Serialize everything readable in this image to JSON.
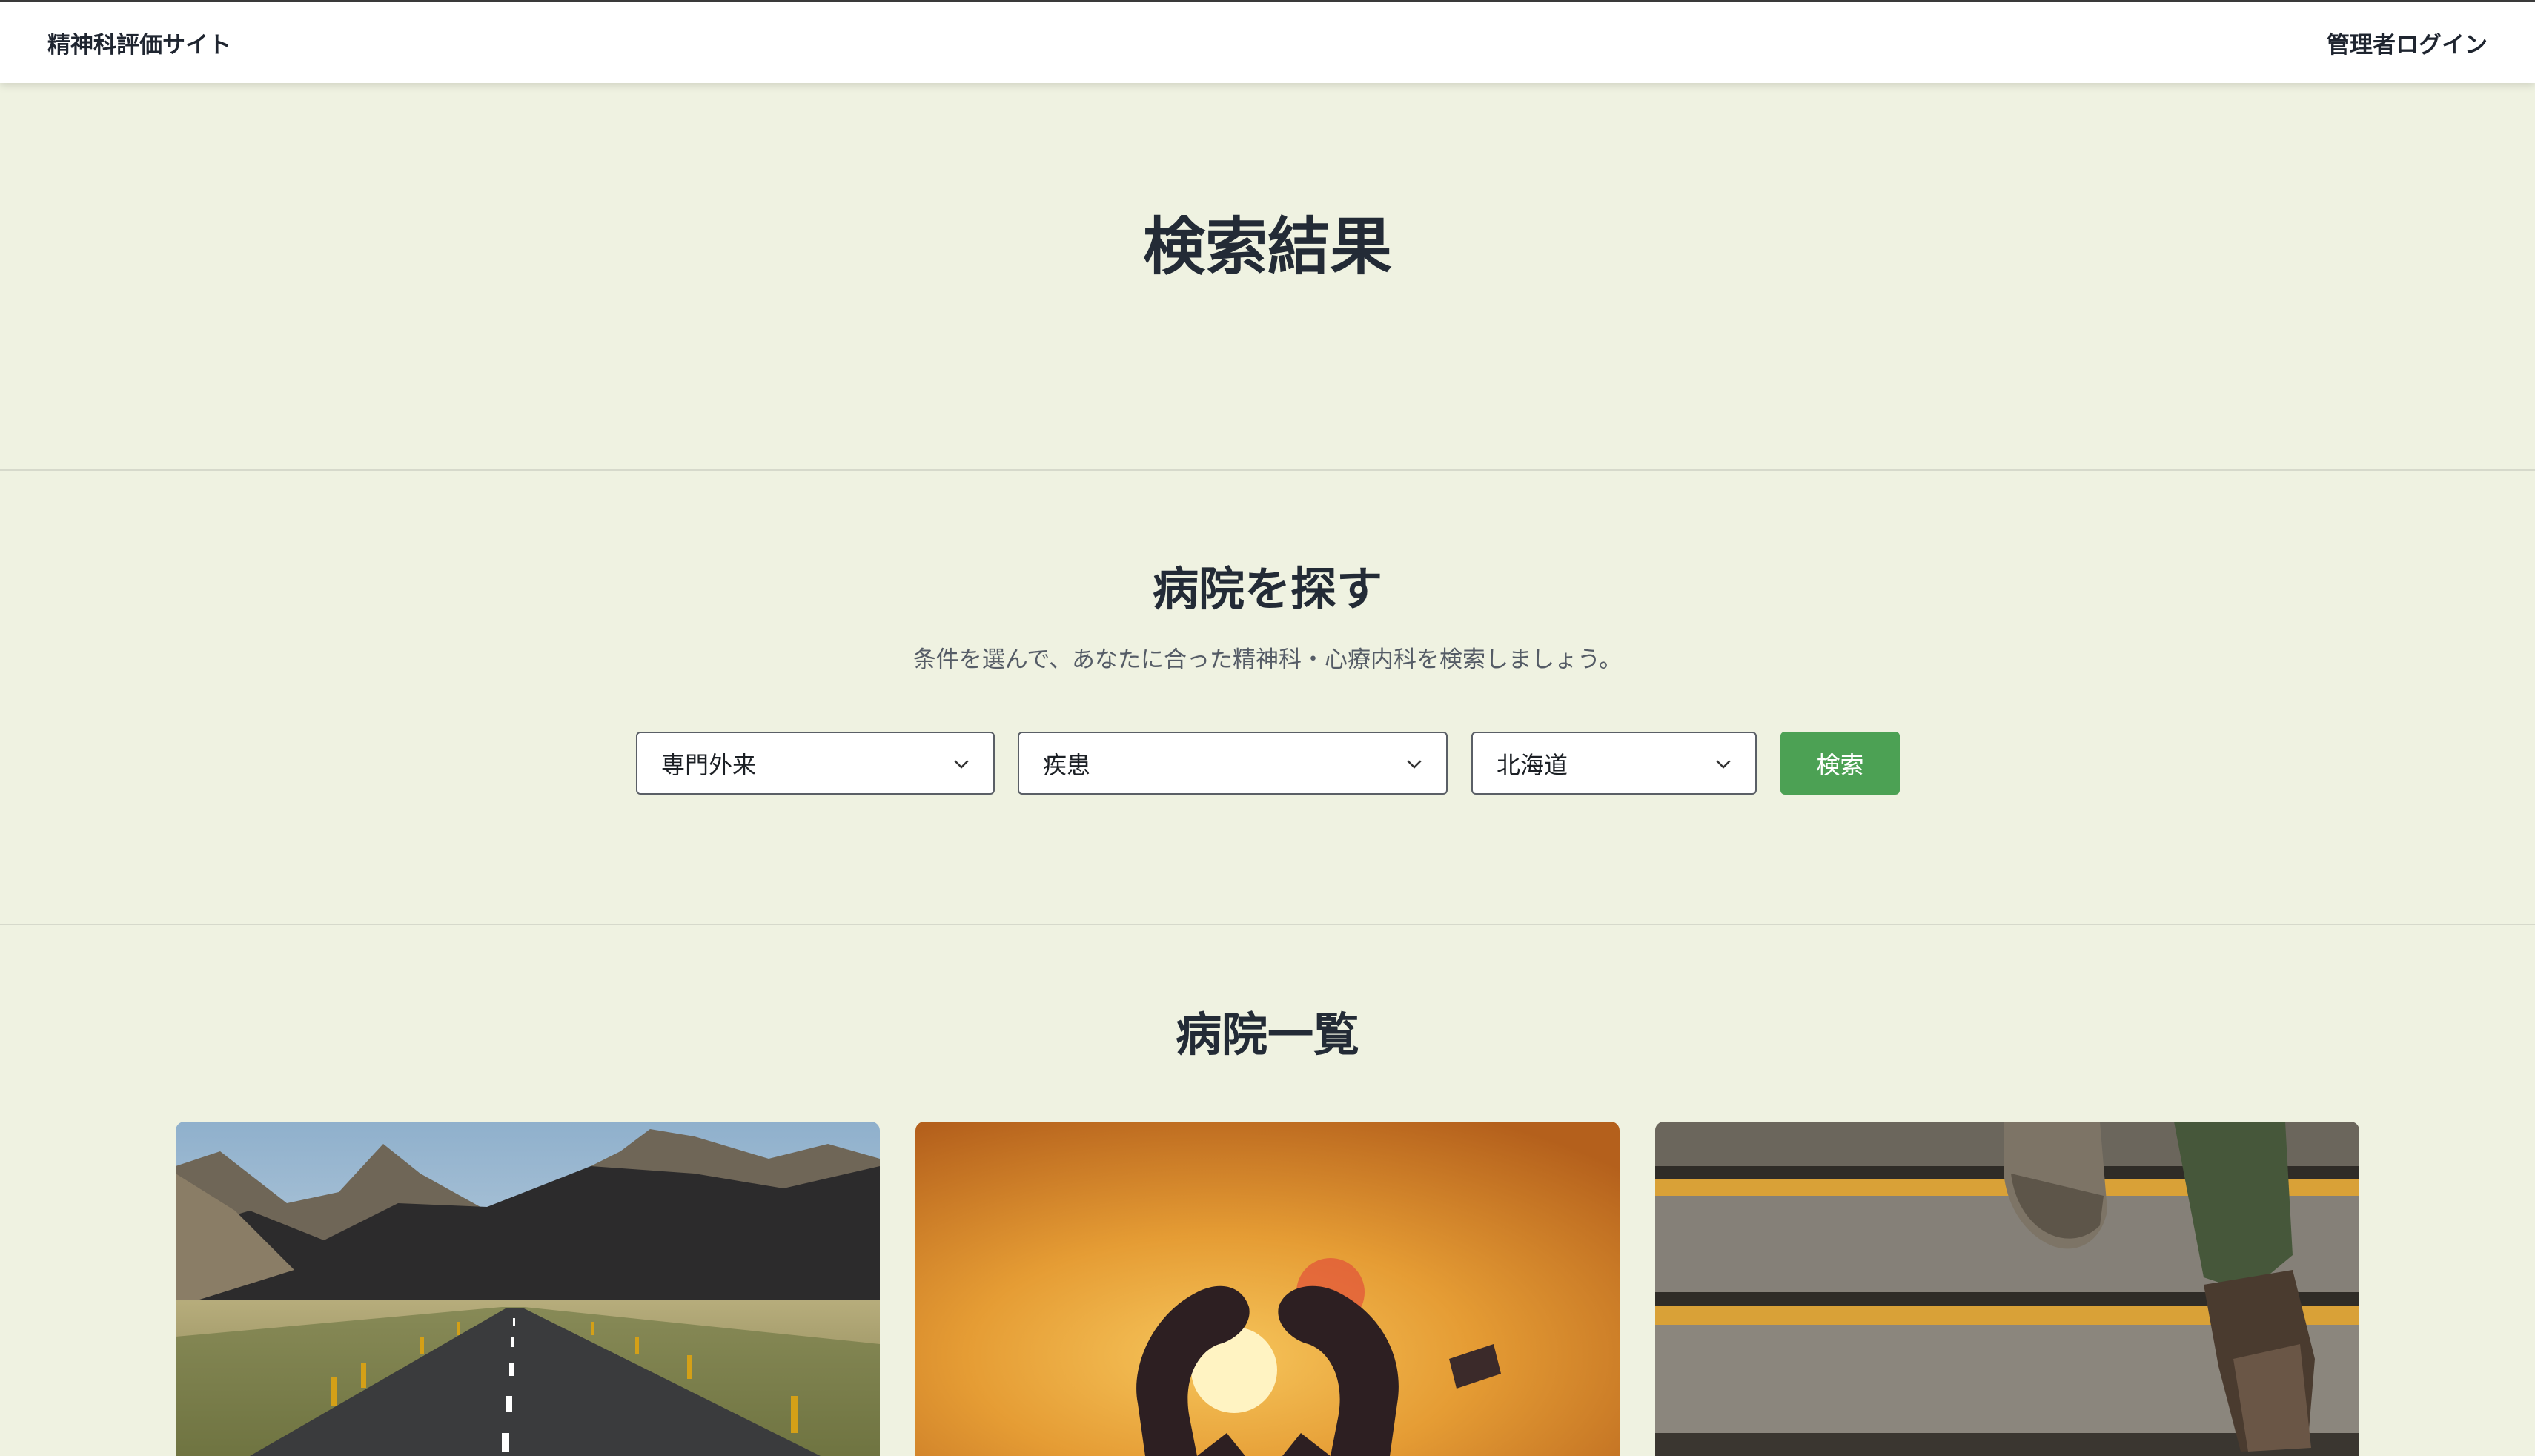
{
  "header": {
    "brand": "精神科評価サイト",
    "admin_login": "管理者ログイン"
  },
  "hero": {
    "title": "検索結果"
  },
  "search": {
    "title": "病院を探す",
    "subtitle": "条件を選んで、あなたに合った精神科・心療内科を検索しましょう。",
    "specialty_select": "専門外来",
    "disease_select": "疾患",
    "region_select": "北海道",
    "button_label": "検索"
  },
  "hospital_list": {
    "title": "病院一覧",
    "cards": [
      {
        "image": "mountain-road-photo"
      },
      {
        "image": "heart-hands-sunset-photo"
      },
      {
        "image": "stairs-sneakers-photo"
      }
    ]
  },
  "colors": {
    "background": "#eff2e1",
    "accent_button": "#4ca154",
    "header_bg": "#ffffff"
  }
}
